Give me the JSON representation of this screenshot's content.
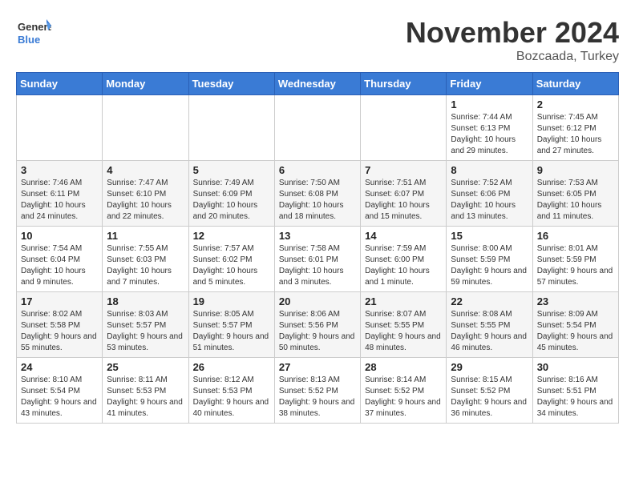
{
  "logo": {
    "line1": "General",
    "line2": "Blue"
  },
  "title": "November 2024",
  "location": "Bozcaada, Turkey",
  "days_of_week": [
    "Sunday",
    "Monday",
    "Tuesday",
    "Wednesday",
    "Thursday",
    "Friday",
    "Saturday"
  ],
  "weeks": [
    [
      {
        "day": "",
        "info": ""
      },
      {
        "day": "",
        "info": ""
      },
      {
        "day": "",
        "info": ""
      },
      {
        "day": "",
        "info": ""
      },
      {
        "day": "",
        "info": ""
      },
      {
        "day": "1",
        "info": "Sunrise: 7:44 AM\nSunset: 6:13 PM\nDaylight: 10 hours and 29 minutes."
      },
      {
        "day": "2",
        "info": "Sunrise: 7:45 AM\nSunset: 6:12 PM\nDaylight: 10 hours and 27 minutes."
      }
    ],
    [
      {
        "day": "3",
        "info": "Sunrise: 7:46 AM\nSunset: 6:11 PM\nDaylight: 10 hours and 24 minutes."
      },
      {
        "day": "4",
        "info": "Sunrise: 7:47 AM\nSunset: 6:10 PM\nDaylight: 10 hours and 22 minutes."
      },
      {
        "day": "5",
        "info": "Sunrise: 7:49 AM\nSunset: 6:09 PM\nDaylight: 10 hours and 20 minutes."
      },
      {
        "day": "6",
        "info": "Sunrise: 7:50 AM\nSunset: 6:08 PM\nDaylight: 10 hours and 18 minutes."
      },
      {
        "day": "7",
        "info": "Sunrise: 7:51 AM\nSunset: 6:07 PM\nDaylight: 10 hours and 15 minutes."
      },
      {
        "day": "8",
        "info": "Sunrise: 7:52 AM\nSunset: 6:06 PM\nDaylight: 10 hours and 13 minutes."
      },
      {
        "day": "9",
        "info": "Sunrise: 7:53 AM\nSunset: 6:05 PM\nDaylight: 10 hours and 11 minutes."
      }
    ],
    [
      {
        "day": "10",
        "info": "Sunrise: 7:54 AM\nSunset: 6:04 PM\nDaylight: 10 hours and 9 minutes."
      },
      {
        "day": "11",
        "info": "Sunrise: 7:55 AM\nSunset: 6:03 PM\nDaylight: 10 hours and 7 minutes."
      },
      {
        "day": "12",
        "info": "Sunrise: 7:57 AM\nSunset: 6:02 PM\nDaylight: 10 hours and 5 minutes."
      },
      {
        "day": "13",
        "info": "Sunrise: 7:58 AM\nSunset: 6:01 PM\nDaylight: 10 hours and 3 minutes."
      },
      {
        "day": "14",
        "info": "Sunrise: 7:59 AM\nSunset: 6:00 PM\nDaylight: 10 hours and 1 minute."
      },
      {
        "day": "15",
        "info": "Sunrise: 8:00 AM\nSunset: 5:59 PM\nDaylight: 9 hours and 59 minutes."
      },
      {
        "day": "16",
        "info": "Sunrise: 8:01 AM\nSunset: 5:59 PM\nDaylight: 9 hours and 57 minutes."
      }
    ],
    [
      {
        "day": "17",
        "info": "Sunrise: 8:02 AM\nSunset: 5:58 PM\nDaylight: 9 hours and 55 minutes."
      },
      {
        "day": "18",
        "info": "Sunrise: 8:03 AM\nSunset: 5:57 PM\nDaylight: 9 hours and 53 minutes."
      },
      {
        "day": "19",
        "info": "Sunrise: 8:05 AM\nSunset: 5:57 PM\nDaylight: 9 hours and 51 minutes."
      },
      {
        "day": "20",
        "info": "Sunrise: 8:06 AM\nSunset: 5:56 PM\nDaylight: 9 hours and 50 minutes."
      },
      {
        "day": "21",
        "info": "Sunrise: 8:07 AM\nSunset: 5:55 PM\nDaylight: 9 hours and 48 minutes."
      },
      {
        "day": "22",
        "info": "Sunrise: 8:08 AM\nSunset: 5:55 PM\nDaylight: 9 hours and 46 minutes."
      },
      {
        "day": "23",
        "info": "Sunrise: 8:09 AM\nSunset: 5:54 PM\nDaylight: 9 hours and 45 minutes."
      }
    ],
    [
      {
        "day": "24",
        "info": "Sunrise: 8:10 AM\nSunset: 5:54 PM\nDaylight: 9 hours and 43 minutes."
      },
      {
        "day": "25",
        "info": "Sunrise: 8:11 AM\nSunset: 5:53 PM\nDaylight: 9 hours and 41 minutes."
      },
      {
        "day": "26",
        "info": "Sunrise: 8:12 AM\nSunset: 5:53 PM\nDaylight: 9 hours and 40 minutes."
      },
      {
        "day": "27",
        "info": "Sunrise: 8:13 AM\nSunset: 5:52 PM\nDaylight: 9 hours and 38 minutes."
      },
      {
        "day": "28",
        "info": "Sunrise: 8:14 AM\nSunset: 5:52 PM\nDaylight: 9 hours and 37 minutes."
      },
      {
        "day": "29",
        "info": "Sunrise: 8:15 AM\nSunset: 5:52 PM\nDaylight: 9 hours and 36 minutes."
      },
      {
        "day": "30",
        "info": "Sunrise: 8:16 AM\nSunset: 5:51 PM\nDaylight: 9 hours and 34 minutes."
      }
    ]
  ]
}
